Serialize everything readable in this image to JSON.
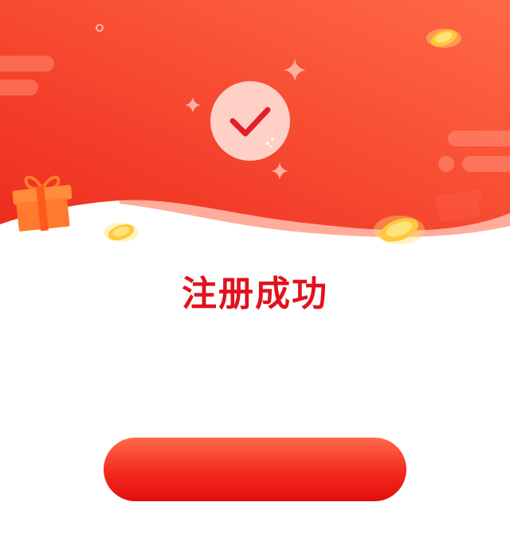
{
  "dialog": {
    "title": "注册成功",
    "confirm_button_label": ""
  },
  "colors": {
    "header_gradient_start": "#ee2c1e",
    "header_gradient_end": "#ff6a45",
    "title": "#e0121d",
    "button": "#f22b1e"
  },
  "icons": {
    "status": "check-icon",
    "decorations": [
      "gift-icon",
      "gold-coin-icon",
      "sparkle-icon",
      "cloud-icon"
    ]
  }
}
